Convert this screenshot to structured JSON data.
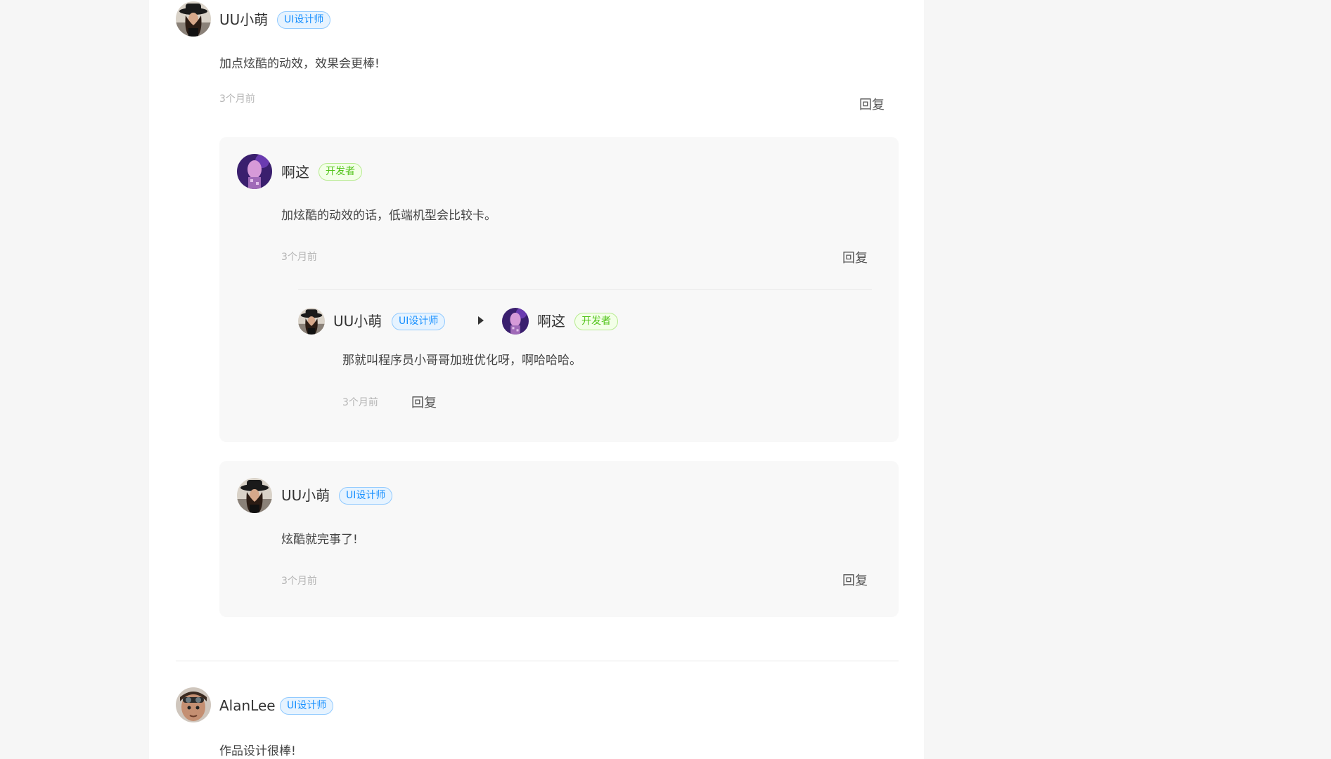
{
  "comments": [
    {
      "author": "UU小萌",
      "badge": "UI设计师",
      "text": "加点炫酷的动效，效果会更棒!",
      "time": "3个月前",
      "reply_label": "回复",
      "replies": [
        {
          "author": "啊这",
          "badge": "开发者",
          "text": "加炫酷的动效的话，低端机型会比较卡。",
          "time": "3个月前",
          "reply_label": "回复",
          "sub_replies": [
            {
              "author": "UU小萌",
              "badge": "UI设计师",
              "reply_to": "啊这",
              "reply_to_badge": "开发者",
              "text": "那就叫程序员小哥哥加班优化呀，啊哈哈哈。",
              "time": "3个月前",
              "reply_label": "回复"
            }
          ]
        },
        {
          "author": "UU小萌",
          "badge": "UI设计师",
          "text": "炫酷就完事了!",
          "time": "3个月前",
          "reply_label": "回复"
        }
      ]
    },
    {
      "author": "AlanLee",
      "badge": "UI设计师",
      "text": "作品设计很棒!"
    }
  ],
  "icons": {
    "avatar_uu": "avatar-woman-hat",
    "avatar_dev": "avatar-purple-figure",
    "avatar_alan": "avatar-man-goggles",
    "reply_to_arrow": "caret-right-icon"
  },
  "colors": {
    "designer_badge": "#1890ff",
    "developer_badge": "#52c41a",
    "reply_box_bg": "#f8f8f8",
    "page_bg": "#f6f6f6"
  }
}
